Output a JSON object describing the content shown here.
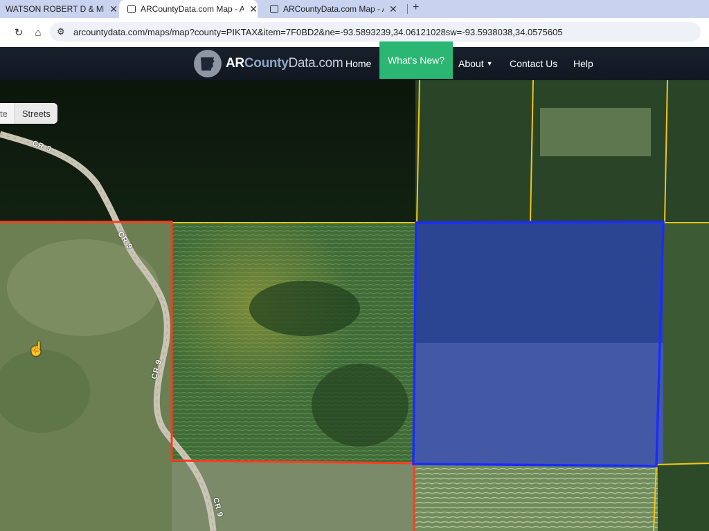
{
  "browser": {
    "tabs": [
      {
        "title": "WATSON ROBERT D & MELISSA",
        "active": false
      },
      {
        "title": "ARCountyData.com Map - ARCo",
        "active": true
      },
      {
        "title": "ARCountyData.com Map - ARC",
        "active": false
      }
    ],
    "url": "arcountydata.com/maps/map?county=PIKTAX&item=7F0BD2&ne=-93.5893239,34.06121028sw=-93.5938038,34.0575605"
  },
  "site": {
    "brand": {
      "part1": "AR",
      "part2": "County",
      "part3": "Data.com"
    },
    "nav": {
      "home": "Home",
      "whats_new": "What's New?",
      "about": "About",
      "contact": "Contact Us",
      "help": "Help"
    },
    "accent_color": "#2bb673"
  },
  "map": {
    "basemap_toggle": {
      "satellite_partial": "te",
      "streets": "Streets"
    },
    "road_labels": [
      "CR 9",
      "CR 9",
      "CR 9",
      "CR 9"
    ],
    "parcel_colors": {
      "selected": "#1a2cff",
      "adjacent": "#ff3b1f",
      "neighbors": "#f5c518"
    }
  }
}
